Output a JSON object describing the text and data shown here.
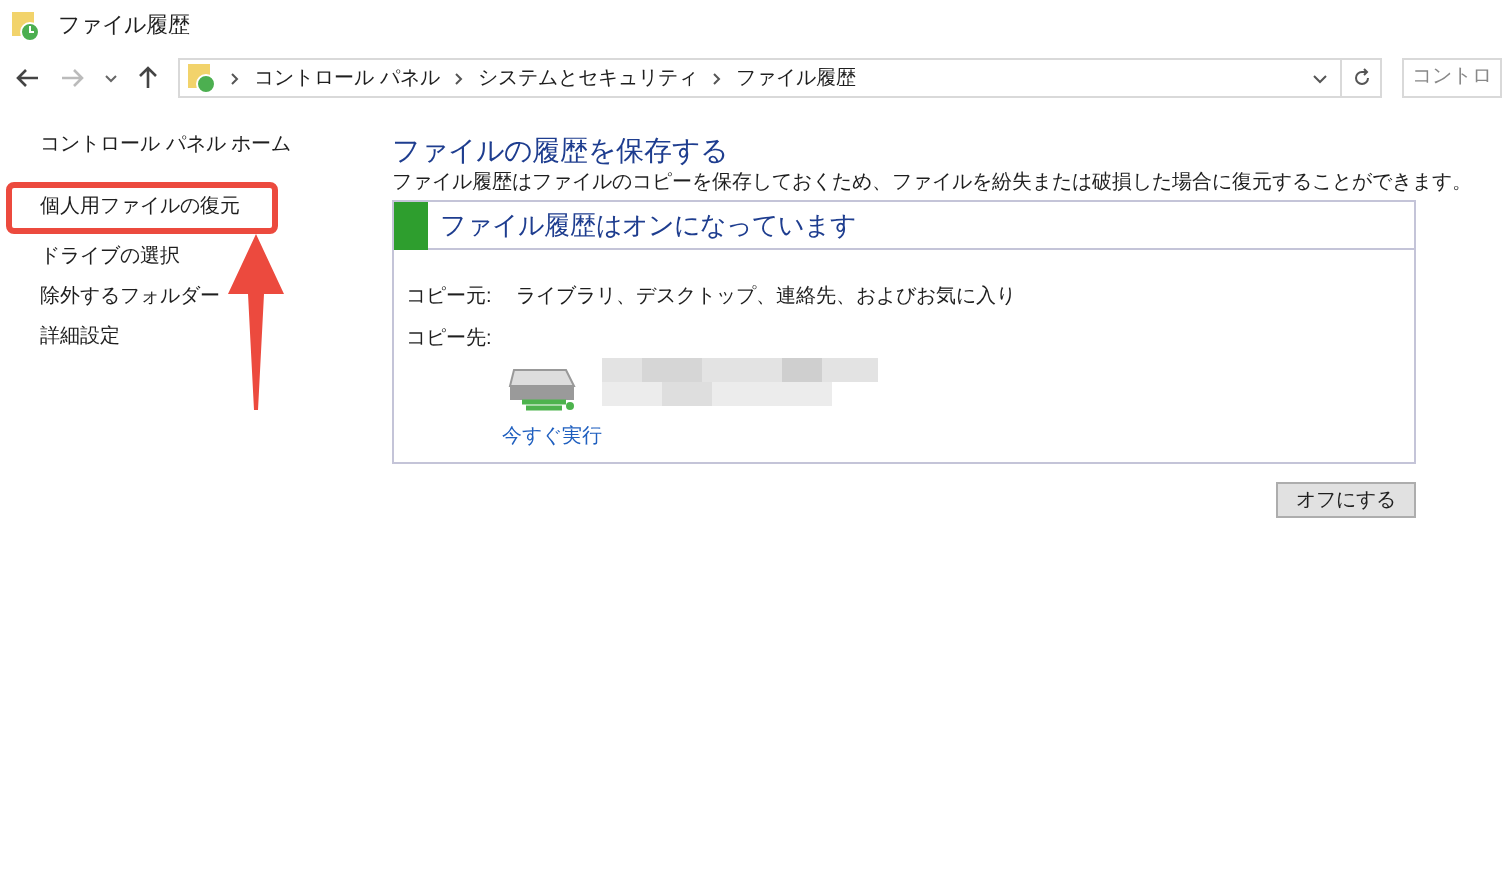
{
  "window": {
    "title": "ファイル履歴"
  },
  "address_bar": {
    "breadcrumbs": [
      "コントロール パネル",
      "システムとセキュリティ",
      "ファイル履歴"
    ],
    "search_placeholder": "コントロ"
  },
  "sidebar": {
    "items": [
      {
        "label": "コントロール パネル ホーム",
        "highlighted": false
      },
      {
        "label": "個人用ファイルの復元",
        "highlighted": true
      },
      {
        "label": "ドライブの選択",
        "highlighted": false
      },
      {
        "label": "除外するフォルダー",
        "highlighted": false
      },
      {
        "label": "詳細設定",
        "highlighted": false
      }
    ]
  },
  "main": {
    "heading": "ファイルの履歴を保存する",
    "description": "ファイル履歴はファイルのコピーを保存しておくため、ファイルを紛失または破損した場合に復元することができます。",
    "status": {
      "title": "ファイル履歴はオンになっています",
      "on": true
    },
    "copy_from": {
      "label": "コピー元:",
      "value": "ライブラリ、デスクトップ、連絡先、およびお気に入り"
    },
    "copy_to": {
      "label": "コピー先:"
    },
    "run_now": "今すぐ実行",
    "turn_off_button": "オフにする"
  }
}
